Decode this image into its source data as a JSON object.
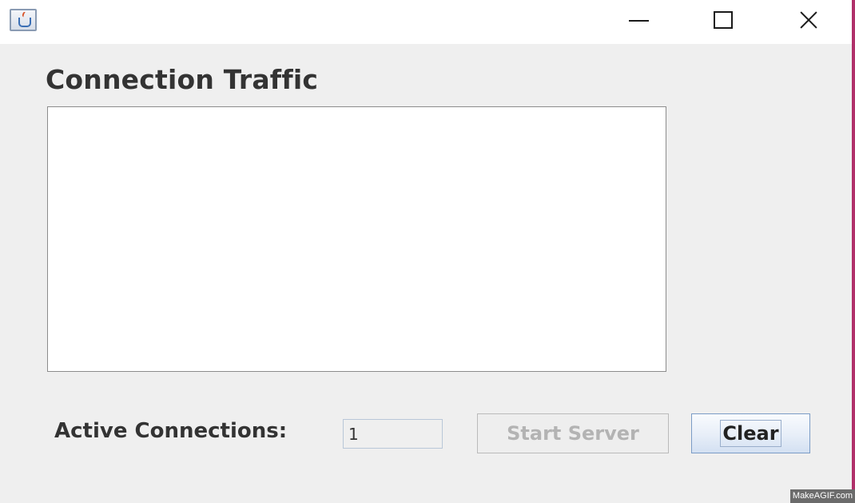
{
  "window": {
    "title": "",
    "app_icon": "java-cup-icon",
    "controls": {
      "minimize_icon": "minimize-icon",
      "maximize_icon": "maximize-icon",
      "close_icon": "close-icon"
    }
  },
  "main": {
    "heading": "Connection Traffic",
    "traffic_log": ""
  },
  "footer": {
    "active_connections_label": "Active Connections:",
    "active_connections_value": "1",
    "start_server_label": "Start Server",
    "clear_label": "Clear"
  },
  "watermark": "MakeAGIF.com",
  "colors": {
    "window_bg": "#efefef",
    "titlebar_bg": "#ffffff",
    "text": "#333333",
    "disabled_text": "#b3b3b3",
    "button_border_focus": "#7b9cc6"
  }
}
